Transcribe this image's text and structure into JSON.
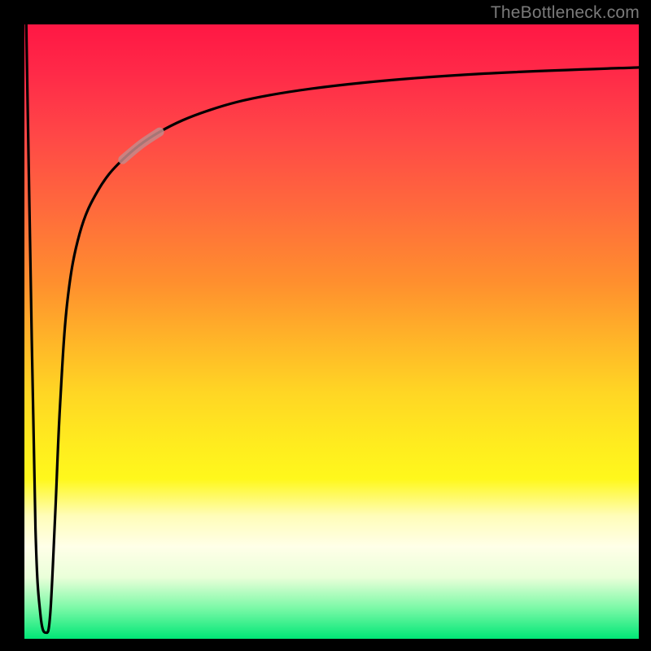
{
  "watermark": "TheBottleneck.com",
  "chart_data": {
    "type": "line",
    "title": "",
    "xlabel": "",
    "ylabel": "",
    "xlim": [
      0,
      100
    ],
    "ylim": [
      0,
      100
    ],
    "grid": false,
    "legend": false,
    "background_gradient": {
      "stops": [
        {
          "pos": 0.0,
          "color": "#ff1744"
        },
        {
          "pos": 0.18,
          "color": "#ff4747"
        },
        {
          "pos": 0.42,
          "color": "#ff8f2e"
        },
        {
          "pos": 0.68,
          "color": "#ffeb1f"
        },
        {
          "pos": 0.85,
          "color": "#ffffe8"
        },
        {
          "pos": 1.0,
          "color": "#00e676"
        }
      ]
    },
    "series": [
      {
        "name": "bottleneck-curve",
        "color": "#000000",
        "x": [
          0.3,
          1.0,
          1.8,
          2.6,
          3.5,
          4.2,
          5.0,
          5.8,
          7.0,
          9.0,
          12.0,
          16.0,
          22.0,
          30.0,
          40.0,
          55.0,
          75.0,
          100.0
        ],
        "values": [
          100,
          60,
          18,
          4,
          1,
          4,
          20,
          38,
          55,
          66,
          73,
          78,
          82.5,
          86,
          88.5,
          90.5,
          92,
          93
        ]
      },
      {
        "name": "highlight-segment",
        "color": "#b88080",
        "thick": true,
        "x": [
          16.0,
          19.0,
          22.0
        ],
        "values": [
          78.0,
          80.5,
          82.5
        ]
      }
    ]
  }
}
